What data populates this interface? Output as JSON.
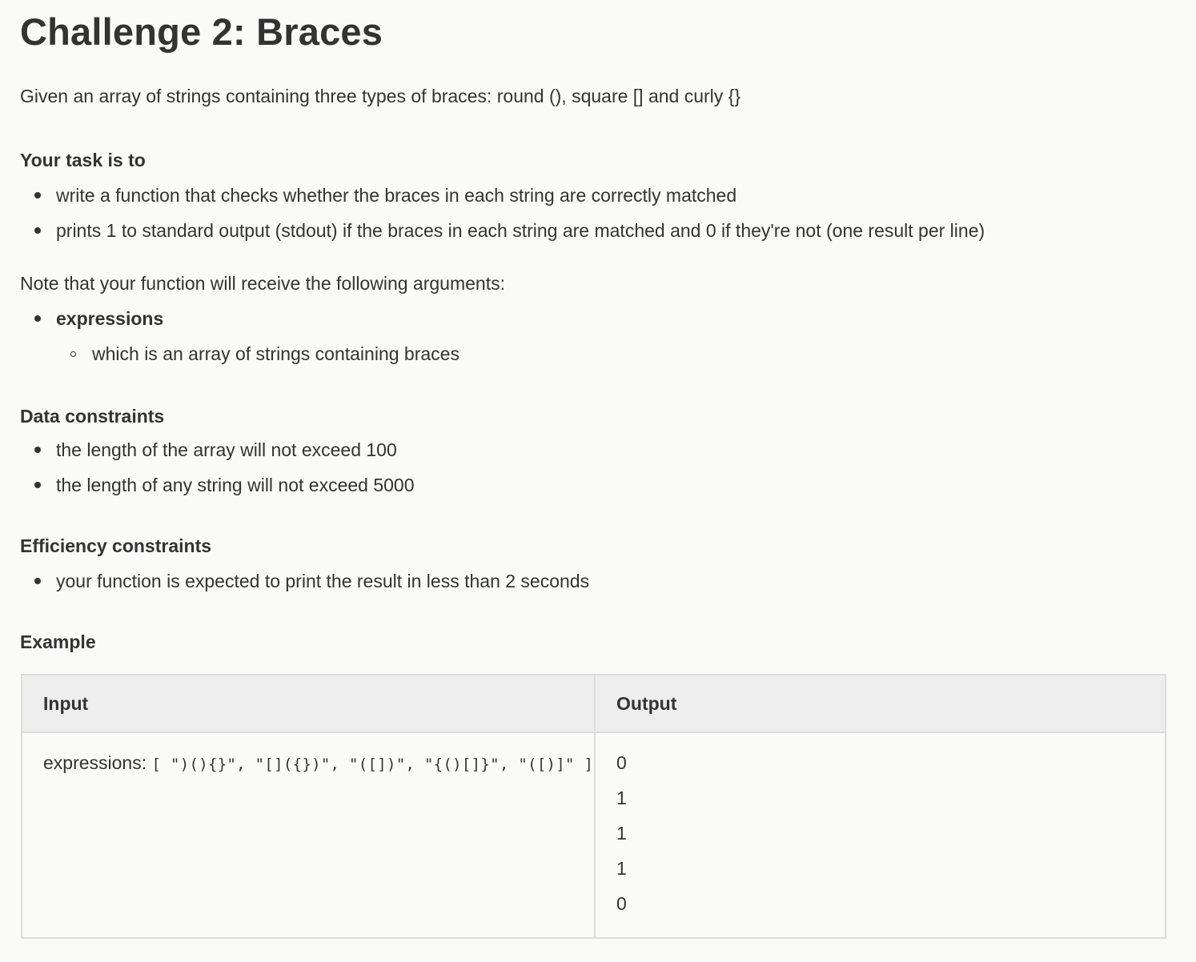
{
  "title": "Challenge 2: Braces",
  "intro": "Given an array of strings containing three types of braces: round (), square [] and curly {}",
  "task": {
    "heading": "Your task is to",
    "items": [
      "write a function that checks whether the braces in each string are correctly matched",
      "prints 1 to standard output (stdout) if the braces in each string are matched and 0 if they're not (one result per line)"
    ]
  },
  "arguments": {
    "note": "Note that your function will receive the following arguments:",
    "name": "expressions",
    "description": "which is an array of strings containing braces"
  },
  "data_constraints": {
    "heading": "Data constraints",
    "items": [
      "the length of the array will not exceed 100",
      "the length of any string will not exceed 5000"
    ]
  },
  "efficiency_constraints": {
    "heading": "Efficiency constraints",
    "items": [
      "your function is expected to print the result in less than 2 seconds"
    ]
  },
  "example": {
    "heading": "Example",
    "columns": [
      "Input",
      "Output"
    ],
    "input_label": "expressions: ",
    "input_value": "[ \")(){}\", \"[]({})\", \"([])\", \"{()[]}\", \"([)]\" ]",
    "outputs": [
      "0",
      "1",
      "1",
      "1",
      "0"
    ]
  }
}
